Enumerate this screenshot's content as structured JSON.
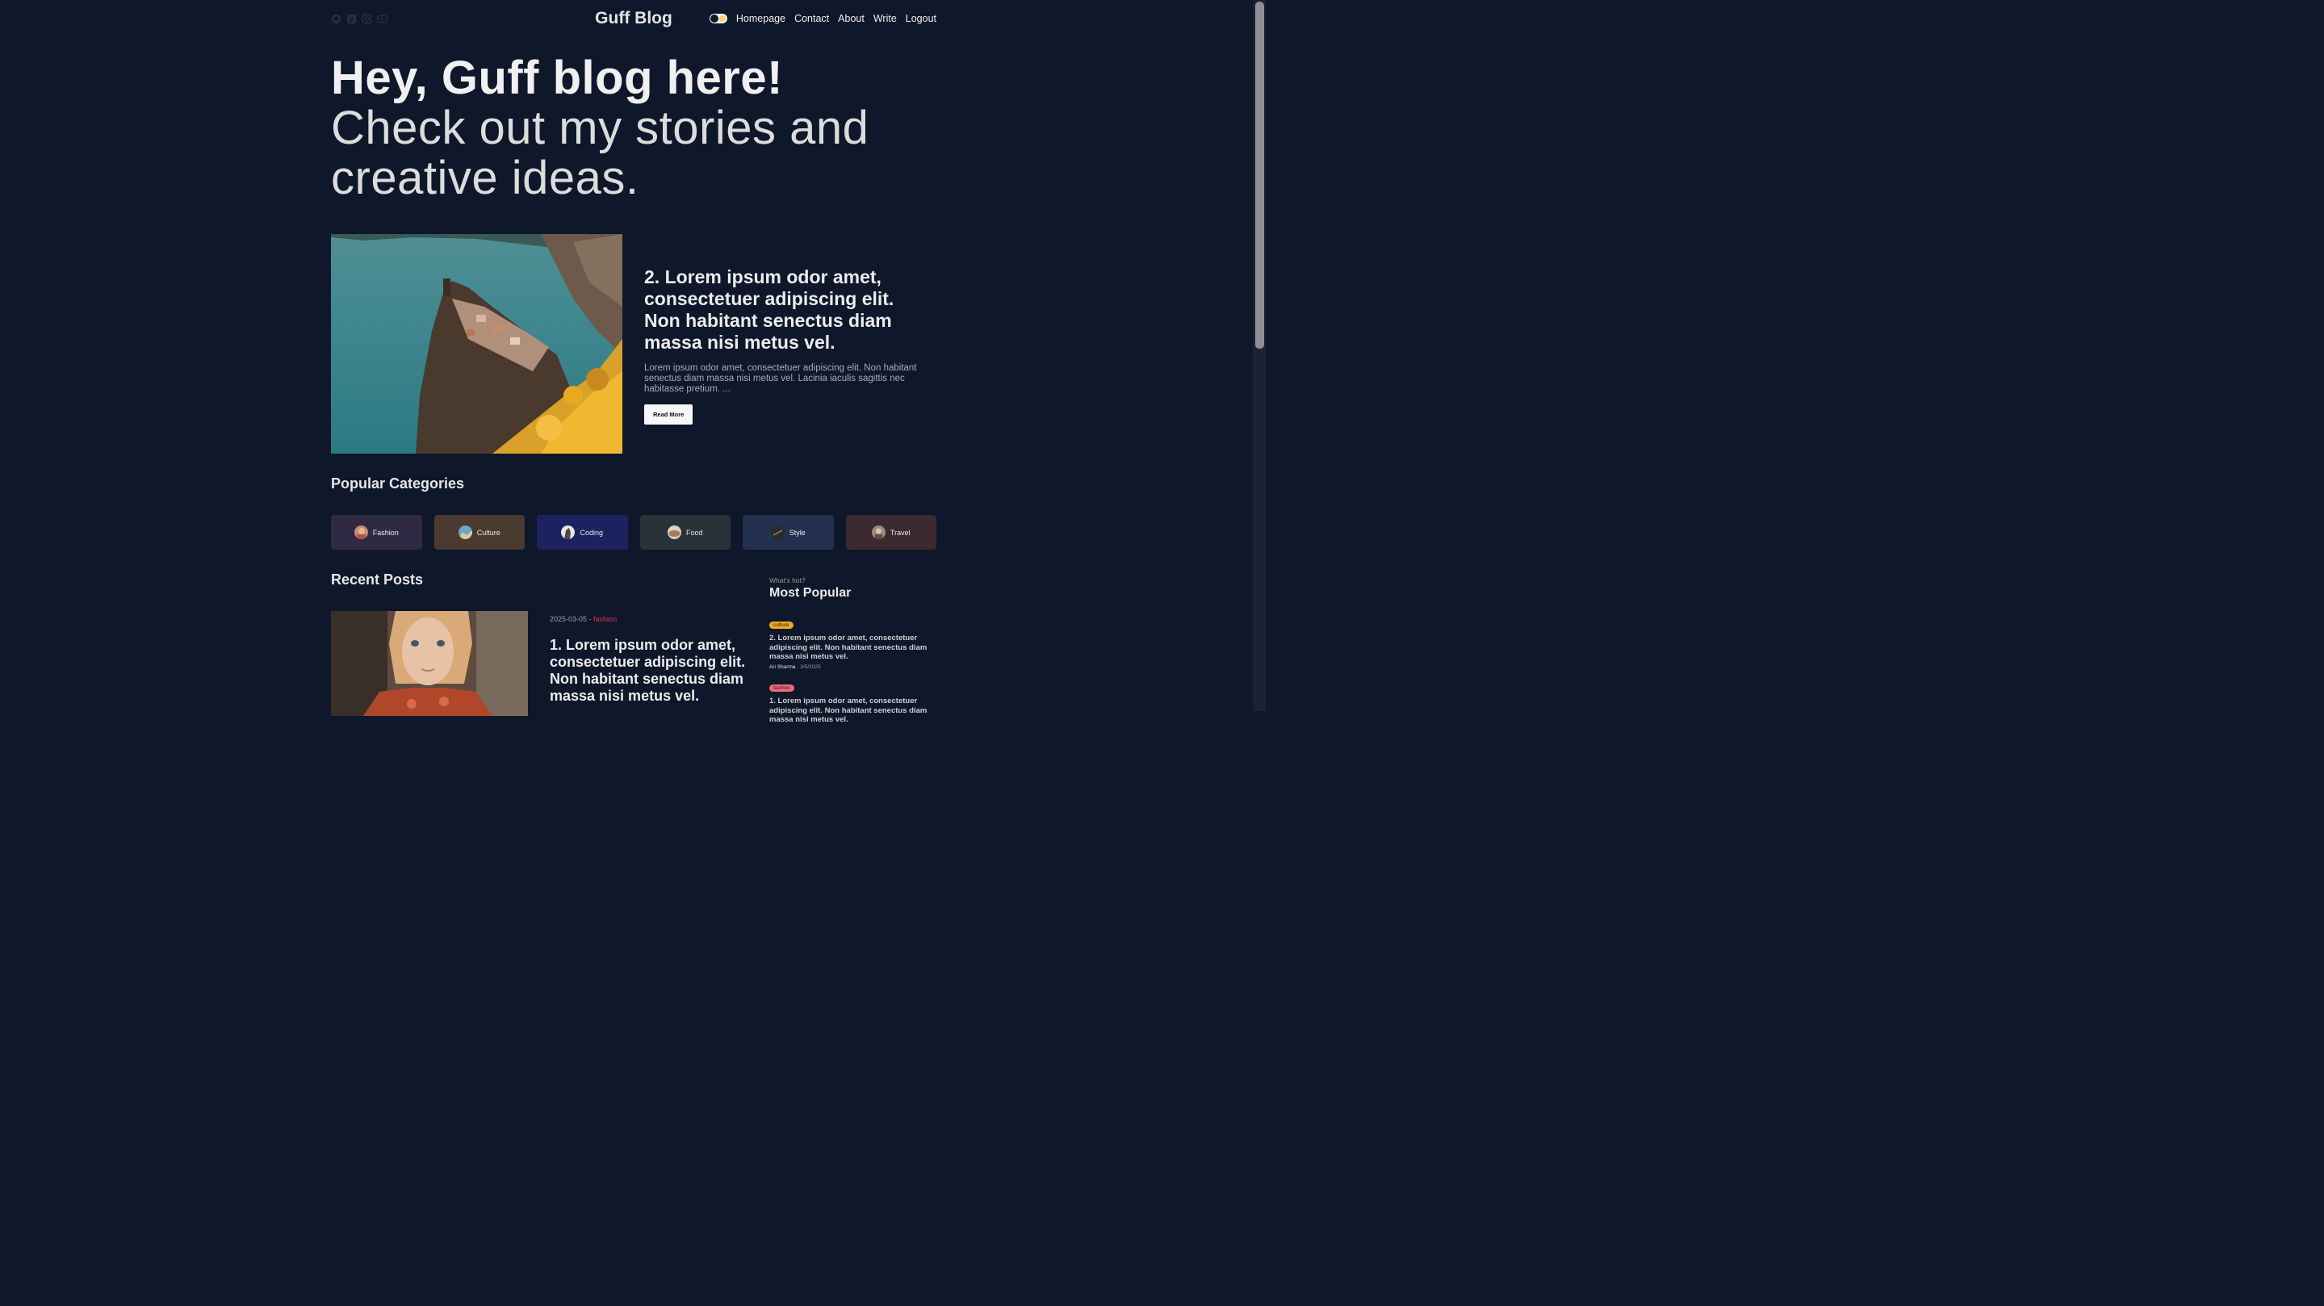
{
  "navbar": {
    "logo": "Guff Blog",
    "socials": [
      "github-icon",
      "tiktok-icon",
      "instagram-icon",
      "youtube-icon"
    ],
    "links": [
      "Homepage",
      "Contact",
      "About",
      "Write",
      "Logout"
    ]
  },
  "hero": {
    "bold": "Hey, Guff blog here!",
    "rest": " Check out my stories and creative ideas."
  },
  "featured": {
    "title": "2. Lorem ipsum odor amet, consectetuer adipiscing elit. Non habitant senectus diam massa nisi metus vel.",
    "desc": "Lorem ipsum odor amet, consectetuer adipiscing elit. Non habitant senectus diam massa nisi metus vel. Lacinia iaculis sagittis nec habitasse pretium. ...",
    "button": "Read More"
  },
  "categories": {
    "title": "Popular Categories",
    "items": [
      {
        "label": "Fashion",
        "color": "#2e2a44"
      },
      {
        "label": "Culture",
        "color": "#4a3a30"
      },
      {
        "label": "Coding",
        "color": "#1c2260"
      },
      {
        "label": "Food",
        "color": "#283238"
      },
      {
        "label": "Style",
        "color": "#233050"
      },
      {
        "label": "Travel",
        "color": "#3c2a30"
      }
    ]
  },
  "recent": {
    "title": "Recent Posts",
    "post": {
      "date": "2025-03-05",
      "separator": " - ",
      "category": "fashion",
      "title": "1. Lorem ipsum odor amet, consectetuer adipiscing elit. Non habitant senectus diam massa nisi metus vel."
    }
  },
  "sidebar": {
    "subtitle": "What's hot?",
    "title": "Most Popular",
    "items": [
      {
        "badge": "culture",
        "badge_color": "#f5a623",
        "title": "2. Lorem ipsum odor amet, consectetuer adipiscing elit. Non habitant senectus diam massa nisi metus vel.",
        "author": "Ari Sharma",
        "date": " - 3/5/2025"
      },
      {
        "badge": "fashion",
        "badge_color": "#ef6b7b",
        "title": "1. Lorem ipsum odor amet, consectetuer adipiscing elit. Non habitant senectus diam massa nisi metus vel."
      }
    ]
  }
}
